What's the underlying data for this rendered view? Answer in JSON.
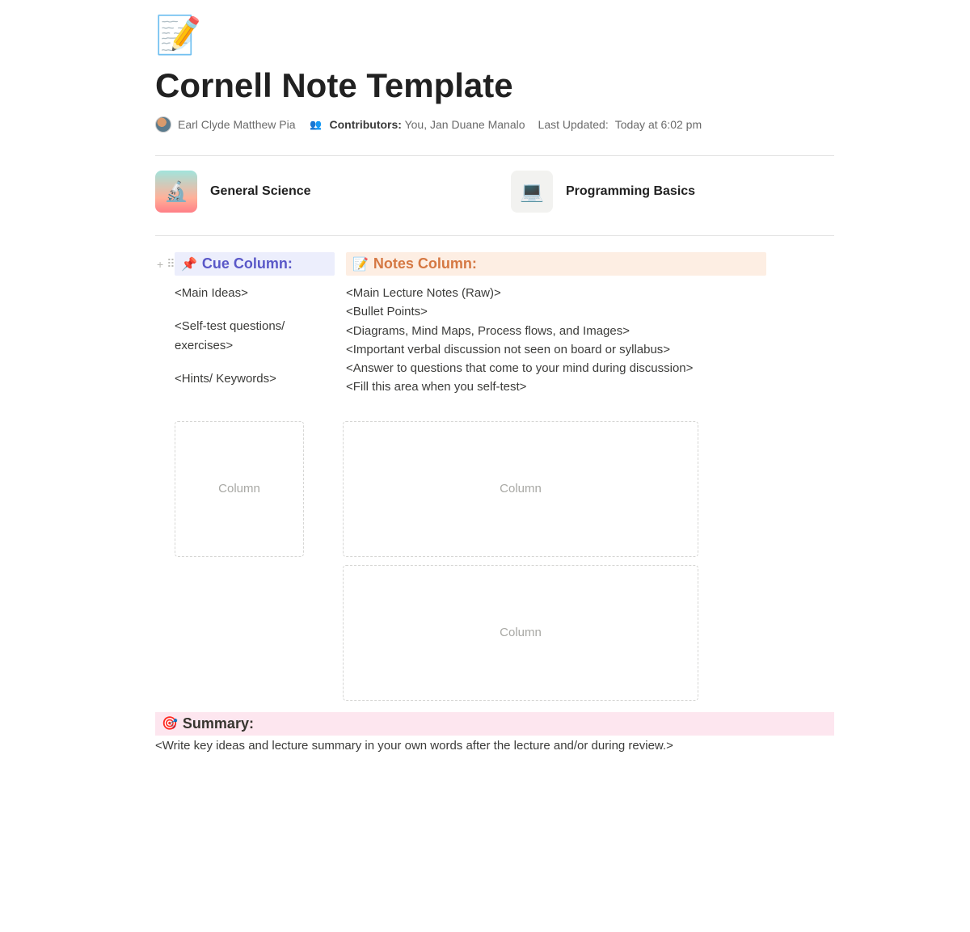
{
  "header": {
    "icon": "📝",
    "title": "Cornell Note Template",
    "author": "Earl Clyde Matthew Pia",
    "contributors_label": "Contributors:",
    "contributors": "You, Jan Duane Manalo",
    "last_updated_label": "Last Updated:",
    "last_updated": "Today at 6:02 pm"
  },
  "cards": [
    {
      "icon": "🔬",
      "title": "General Science"
    },
    {
      "icon": "💻",
      "title": "Programming Basics"
    }
  ],
  "cue": {
    "heading_icon": "📌",
    "heading": "Cue Column:",
    "items": [
      "<Main Ideas>",
      "",
      "<Self-test questions/ exercises>",
      "",
      "<Hints/ Keywords>"
    ]
  },
  "notes": {
    "heading_icon": "📝",
    "heading": "Notes Column:",
    "items": [
      "<Main Lecture Notes (Raw)>",
      "<Bullet Points>",
      "<Diagrams, Mind Maps, Process flows, and Images>",
      "<Important verbal discussion not seen on board or syllabus>",
      "<Answer to questions that come to your mind during discussion>",
      "<Fill this area when you self-test>"
    ]
  },
  "placeholders": {
    "label": "Column"
  },
  "summary": {
    "heading_icon": "🎯",
    "heading": "Summary:",
    "body": "<Write key ideas and lecture summary in your own words after the lecture and/or during review.>"
  },
  "gutter": {
    "plus": "+",
    "drag": "⠿"
  }
}
